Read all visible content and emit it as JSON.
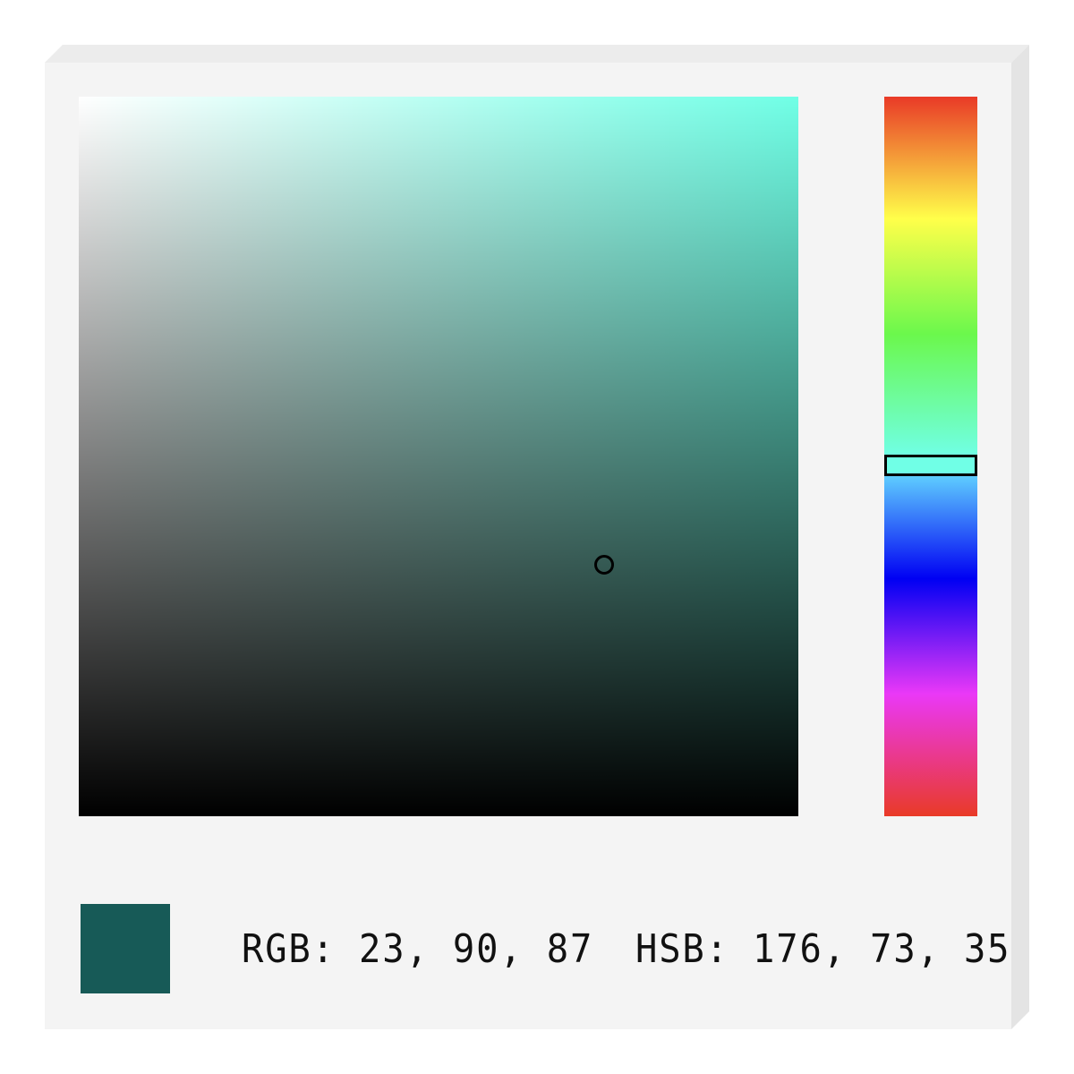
{
  "color_picker": {
    "hue": 176,
    "saturation": 73,
    "brightness": 35,
    "rgb_text": "RGB: 23, 90, 87",
    "hsb_text": "HSB: 176, 73, 35",
    "current_color": "#175a57",
    "pure_hue_color": "#70ffe6",
    "hue_handle_color": "#70ffe6"
  }
}
